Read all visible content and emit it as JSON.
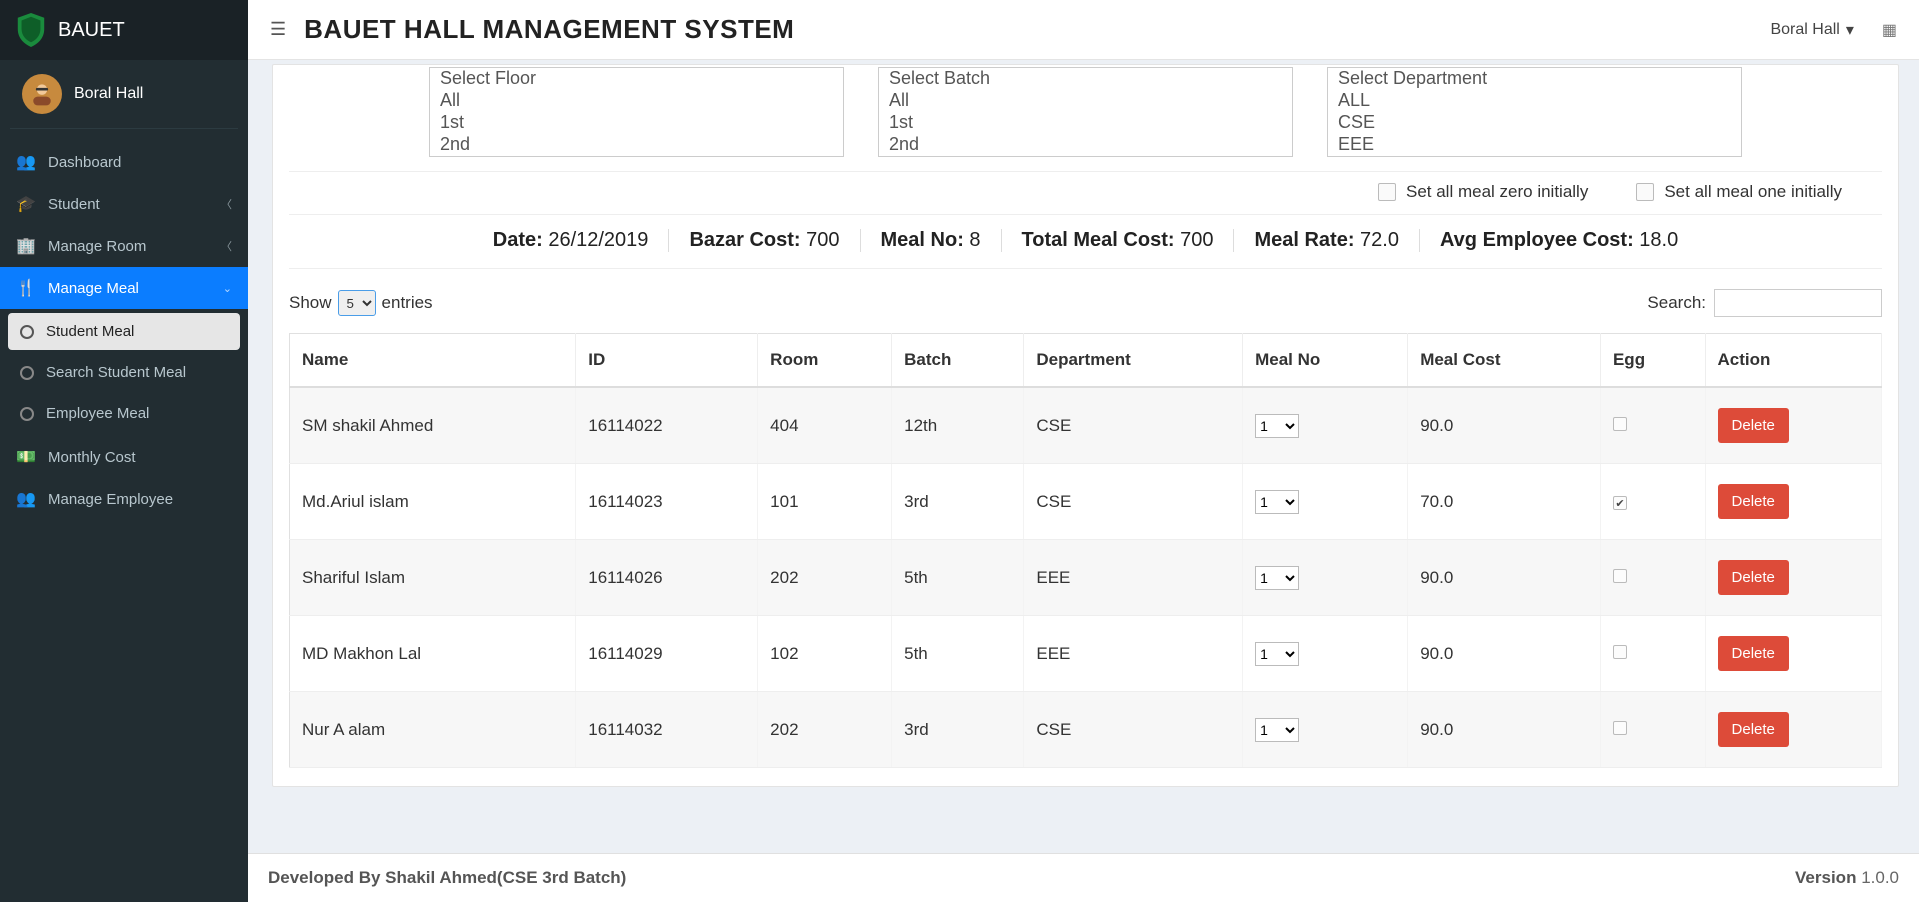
{
  "brand": "BAUET",
  "user": {
    "name": "Boral Hall"
  },
  "sidebar": {
    "dashboard": "Dashboard",
    "student": "Student",
    "manage_room": "Manage Room",
    "manage_meal": "Manage Meal",
    "student_meal": "Student Meal",
    "search_student_meal": "Search Student Meal",
    "employee_meal": "Employee Meal",
    "monthly_cost": "Monthly Cost",
    "manage_employee": "Manage Employee"
  },
  "header": {
    "title": "BAUET HALL MANAGEMENT SYSTEM",
    "hall_name": "Boral Hall"
  },
  "filters": {
    "floor": [
      "Select Floor",
      "All",
      "1st",
      "2nd"
    ],
    "batch": [
      "Select Batch",
      "All",
      "1st",
      "2nd"
    ],
    "department": [
      "Select Department",
      "ALL",
      "CSE",
      "EEE"
    ]
  },
  "checks": {
    "zero": "Set all meal zero initially",
    "one": "Set all meal one initially"
  },
  "stats": {
    "date_label": "Date:",
    "date_value": "26/12/2019",
    "bazar_label": "Bazar Cost:",
    "bazar_value": "700",
    "mealno_label": "Meal No:",
    "mealno_value": "8",
    "totalmeal_label": "Total Meal Cost:",
    "totalmeal_value": "700",
    "mealrate_label": "Meal Rate:",
    "mealrate_value": "72.0",
    "avgemp_label": "Avg Employee Cost:",
    "avgemp_value": "18.0"
  },
  "table": {
    "show_label": "Show",
    "entries_label": "entries",
    "entries_value": "5",
    "search_label": "Search:",
    "headers": {
      "name": "Name",
      "id": "ID",
      "room": "Room",
      "batch": "Batch",
      "dept": "Department",
      "mealno": "Meal No",
      "mealcost": "Meal Cost",
      "egg": "Egg",
      "action": "Action"
    },
    "delete_label": "Delete",
    "rows": [
      {
        "name": "SM shakil Ahmed",
        "id": "16114022",
        "room": "404",
        "batch": "12th",
        "dept": "CSE",
        "mealno": "1",
        "mealcost": "90.0",
        "egg": false
      },
      {
        "name": "Md.Ariul islam",
        "id": "16114023",
        "room": "101",
        "batch": "3rd",
        "dept": "CSE",
        "mealno": "1",
        "mealcost": "70.0",
        "egg": true
      },
      {
        "name": "Shariful Islam",
        "id": "16114026",
        "room": "202",
        "batch": "5th",
        "dept": "EEE",
        "mealno": "1",
        "mealcost": "90.0",
        "egg": false
      },
      {
        "name": "MD Makhon Lal",
        "id": "16114029",
        "room": "102",
        "batch": "5th",
        "dept": "EEE",
        "mealno": "1",
        "mealcost": "90.0",
        "egg": false
      },
      {
        "name": "Nur A alam",
        "id": "16114032",
        "room": "202",
        "batch": "3rd",
        "dept": "CSE",
        "mealno": "1",
        "mealcost": "90.0",
        "egg": false
      }
    ]
  },
  "footer": {
    "left": "Developed By Shakil Ahmed(CSE 3rd Batch)",
    "right_label": "Version",
    "right_value": "1.0.0"
  }
}
